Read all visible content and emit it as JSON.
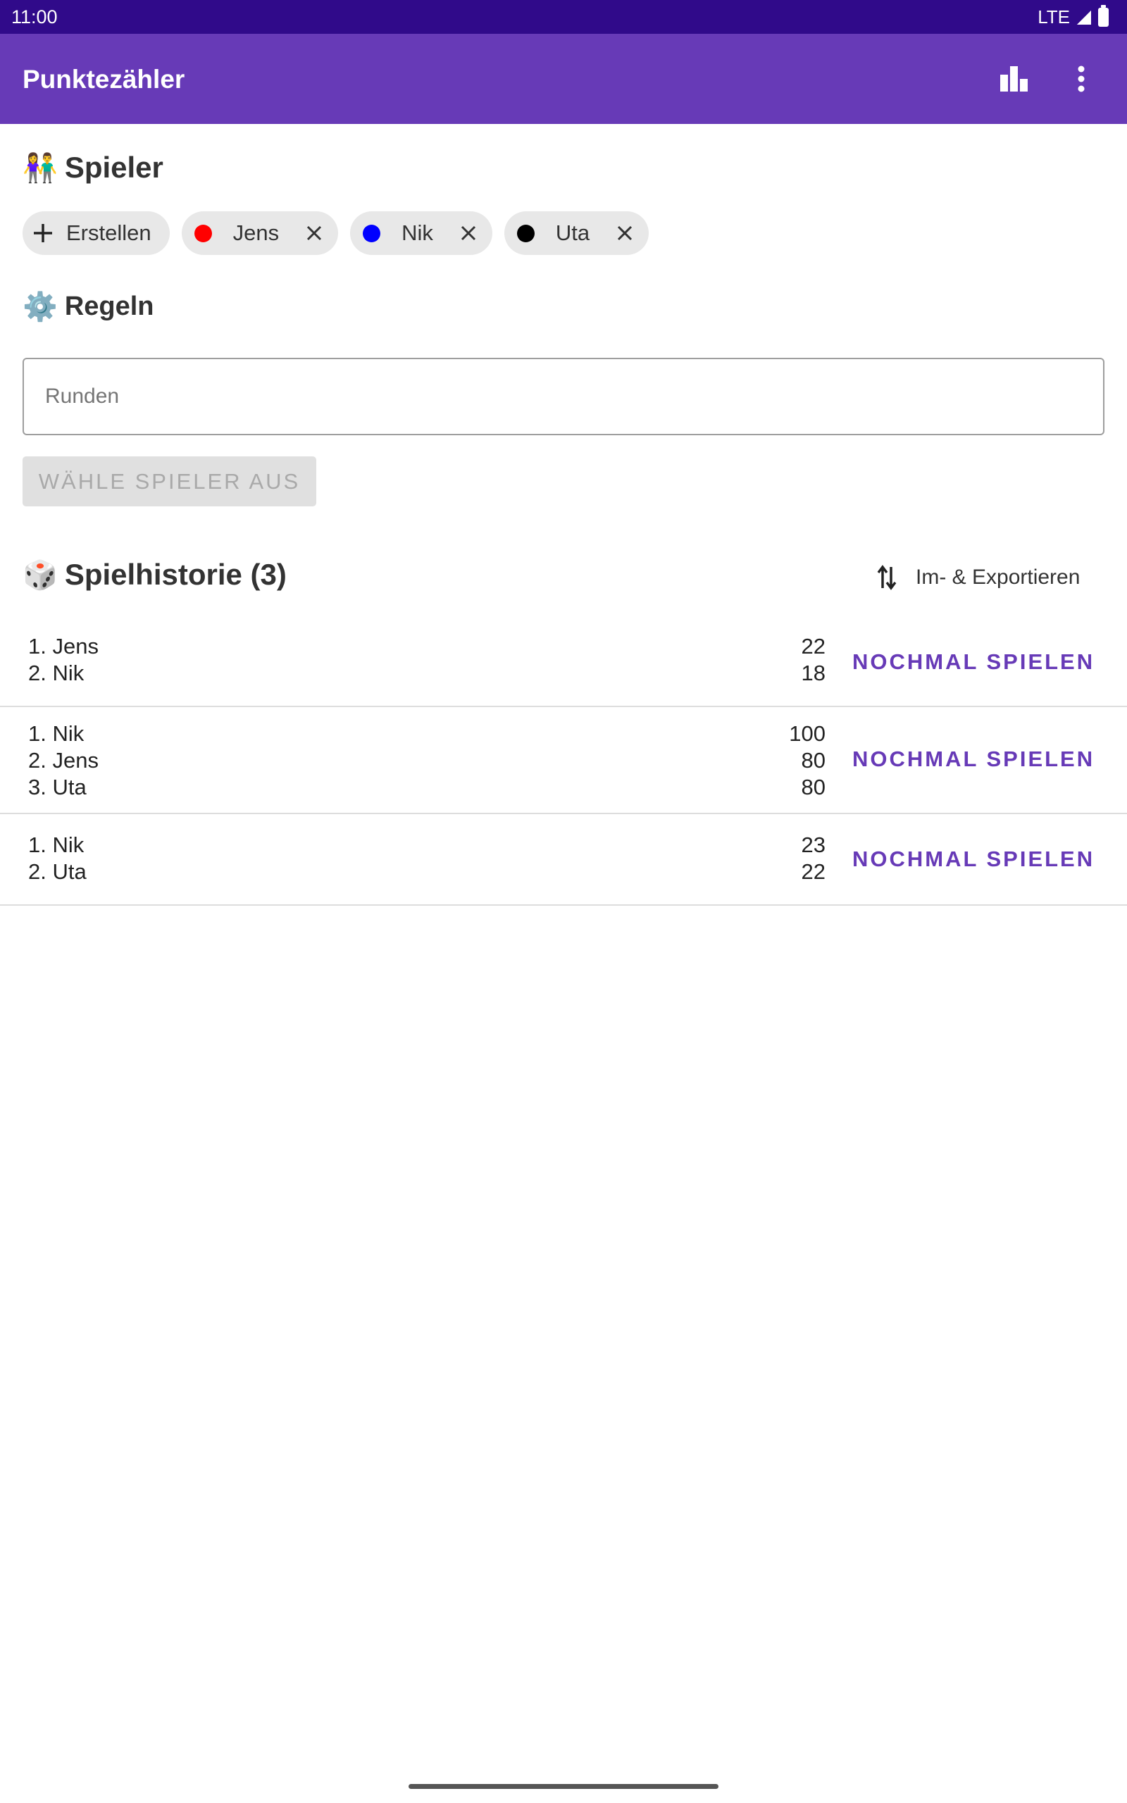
{
  "status_bar": {
    "time": "11:00",
    "network": "LTE"
  },
  "app_bar": {
    "title": "Punktezähler"
  },
  "players_section": {
    "emoji": "👫",
    "title": "Spieler",
    "create_label": "Erstellen",
    "players": [
      {
        "name": "Jens",
        "color": "#ff0000"
      },
      {
        "name": "Nik",
        "color": "#0000ff"
      },
      {
        "name": "Uta",
        "color": "#000000"
      }
    ]
  },
  "rules_section": {
    "emoji": "⚙️",
    "title": "Regeln",
    "rounds_placeholder": "Runden",
    "choose_button": "WÄHLE SPIELER AUS"
  },
  "history_section": {
    "emoji": "🎲",
    "title": "Spielhistorie (3)",
    "export_label": "Im- & Exportieren",
    "replay_label": "NOCHMAL SPIELEN",
    "games": [
      {
        "rows": [
          {
            "rank": "1. Jens",
            "score": "22"
          },
          {
            "rank": "2. Nik",
            "score": "18"
          }
        ]
      },
      {
        "rows": [
          {
            "rank": "1. Nik",
            "score": "100"
          },
          {
            "rank": "2. Jens",
            "score": "80"
          },
          {
            "rank": "3. Uta",
            "score": "80"
          }
        ]
      },
      {
        "rows": [
          {
            "rank": "1. Nik",
            "score": "23"
          },
          {
            "rank": "2. Uta",
            "score": "22"
          }
        ]
      }
    ]
  },
  "colors": {
    "primary": "#673ab7",
    "status_bar": "#300a8a"
  }
}
